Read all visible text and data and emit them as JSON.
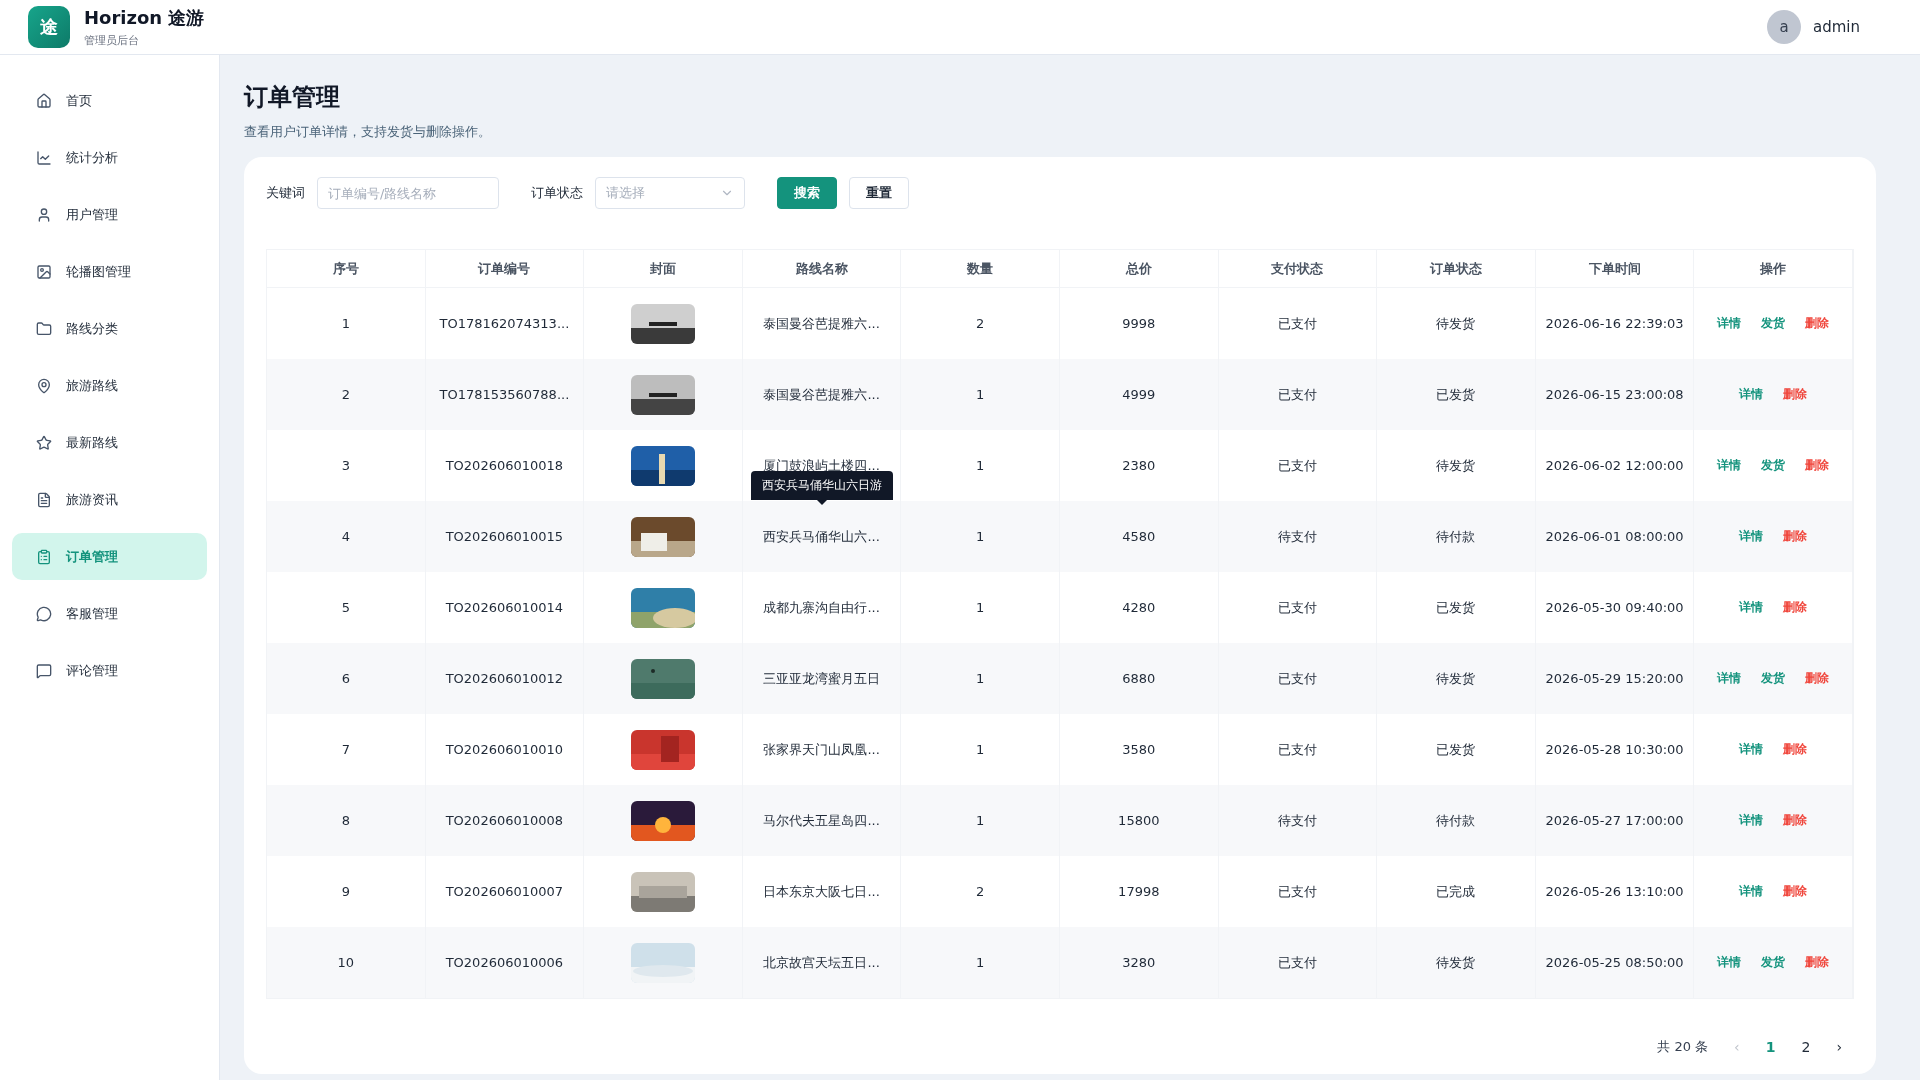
{
  "app": {
    "logo": "途",
    "name": "Horizon 途游",
    "subtitle": "管理员后台"
  },
  "user": {
    "avatar": "a",
    "name": "admin"
  },
  "sidebar": {
    "items": [
      {
        "label": "首页",
        "selected": false
      },
      {
        "label": "统计分析",
        "selected": false
      },
      {
        "label": "用户管理",
        "selected": false
      },
      {
        "label": "轮播图管理",
        "selected": false
      },
      {
        "label": "路线分类",
        "selected": false
      },
      {
        "label": "旅游路线",
        "selected": false
      },
      {
        "label": "最新路线",
        "selected": false
      },
      {
        "label": "旅游资讯",
        "selected": false
      },
      {
        "label": "订单管理",
        "selected": true
      },
      {
        "label": "客服管理",
        "selected": false
      },
      {
        "label": "评论管理",
        "selected": false
      }
    ]
  },
  "page": {
    "title": "订单管理",
    "description": "查看用户订单详情，支持发货与删除操作。"
  },
  "filters": {
    "keyword_label": "关键词",
    "keyword_placeholder": "订单编号/路线名称",
    "status_label": "订单状态",
    "status_placeholder": "请选择",
    "search_button": "搜索",
    "reset_button": "重置"
  },
  "table": {
    "columns": [
      "序号",
      "订单编号",
      "封面",
      "路线名称",
      "数量",
      "总价",
      "支付状态",
      "订单状态",
      "下单时间",
      "操作"
    ],
    "rows": [
      {
        "index": "1",
        "order_no": "TO178162074313...",
        "cover": {
          "kind": "picture"
        },
        "route": "泰国曼谷芭提雅六...",
        "qty": "2",
        "total": "9998",
        "payment": "已支付",
        "status": "待发货",
        "time": "2026-06-16 22:39:03",
        "actions": [
          {
            "kind": "detail",
            "label": "详情"
          },
          {
            "kind": "ship",
            "label": "发货"
          },
          {
            "kind": "delete",
            "label": "删除"
          }
        ]
      },
      {
        "index": "2",
        "order_no": "TO178153560788...",
        "cover": {
          "kind": "picture"
        },
        "route": "泰国曼谷芭提雅六...",
        "qty": "1",
        "total": "4999",
        "payment": "已支付",
        "status": "已发货",
        "time": "2026-06-15 23:00:08",
        "actions": [
          {
            "kind": "detail",
            "label": "详情"
          },
          {
            "kind": "delete",
            "label": "删除"
          }
        ]
      },
      {
        "index": "3",
        "order_no": "TO202606010018",
        "cover": {
          "kind": "picture"
        },
        "route": "厦门鼓浪屿土楼四...",
        "qty": "1",
        "total": "2380",
        "payment": "已支付",
        "status": "待发货",
        "time": "2026-06-02 12:00:00",
        "actions": [
          {
            "kind": "detail",
            "label": "详情"
          },
          {
            "kind": "ship",
            "label": "发货"
          },
          {
            "kind": "delete",
            "label": "删除"
          }
        ]
      },
      {
        "index": "4",
        "order_no": "TO202606010015",
        "cover": {
          "kind": "picture"
        },
        "route": "西安兵马俑华山六...",
        "tooltip": "西安兵马俑华山六日游",
        "qty": "1",
        "total": "4580",
        "payment": "待支付",
        "status": "待付款",
        "time": "2026-06-01 08:00:00",
        "actions": [
          {
            "kind": "detail",
            "label": "详情"
          },
          {
            "kind": "delete",
            "label": "删除"
          }
        ]
      },
      {
        "index": "5",
        "order_no": "TO202606010014",
        "cover": {
          "kind": "picture"
        },
        "route": "成都九寨沟自由行...",
        "qty": "1",
        "total": "4280",
        "payment": "已支付",
        "status": "已发货",
        "time": "2026-05-30 09:40:00",
        "actions": [
          {
            "kind": "detail",
            "label": "详情"
          },
          {
            "kind": "delete",
            "label": "删除"
          }
        ]
      },
      {
        "index": "6",
        "order_no": "TO202606010012",
        "cover": {
          "kind": "picture"
        },
        "route": "三亚亚龙湾蜜月五日",
        "qty": "1",
        "total": "6880",
        "payment": "已支付",
        "status": "待发货",
        "time": "2026-05-29 15:20:00",
        "actions": [
          {
            "kind": "detail",
            "label": "详情"
          },
          {
            "kind": "ship",
            "label": "发货"
          },
          {
            "kind": "delete",
            "label": "删除"
          }
        ]
      },
      {
        "index": "7",
        "order_no": "TO202606010010",
        "cover": {
          "kind": "picture"
        },
        "route": "张家界天门山凤凰...",
        "qty": "1",
        "total": "3580",
        "payment": "已支付",
        "status": "已发货",
        "time": "2026-05-28 10:30:00",
        "actions": [
          {
            "kind": "detail",
            "label": "详情"
          },
          {
            "kind": "delete",
            "label": "删除"
          }
        ]
      },
      {
        "index": "8",
        "order_no": "TO202606010008",
        "cover": {
          "kind": "picture"
        },
        "route": "马尔代夫五星岛四...",
        "qty": "1",
        "total": "15800",
        "payment": "待支付",
        "status": "待付款",
        "time": "2026-05-27 17:00:00",
        "actions": [
          {
            "kind": "detail",
            "label": "详情"
          },
          {
            "kind": "delete",
            "label": "删除"
          }
        ]
      },
      {
        "index": "9",
        "order_no": "TO202606010007",
        "cover": {
          "kind": "picture"
        },
        "route": "日本东京大阪七日...",
        "qty": "2",
        "total": "17998",
        "payment": "已支付",
        "status": "已完成",
        "time": "2026-05-26 13:10:00",
        "actions": [
          {
            "kind": "detail",
            "label": "详情"
          },
          {
            "kind": "delete",
            "label": "删除"
          }
        ]
      },
      {
        "index": "10",
        "order_no": "TO202606010006",
        "cover": {
          "kind": "picture"
        },
        "route": "北京故宫天坛五日...",
        "qty": "1",
        "total": "3280",
        "payment": "已支付",
        "status": "待发货",
        "time": "2026-05-25 08:50:00",
        "actions": [
          {
            "kind": "detail",
            "label": "详情"
          },
          {
            "kind": "ship",
            "label": "发货"
          },
          {
            "kind": "delete",
            "label": "删除"
          }
        ]
      }
    ]
  },
  "pagination": {
    "total": "共 20 条",
    "prev": "‹",
    "pages": [
      {
        "label": "1",
        "selected": true
      },
      {
        "label": "2",
        "selected": false
      }
    ],
    "next": "›"
  }
}
